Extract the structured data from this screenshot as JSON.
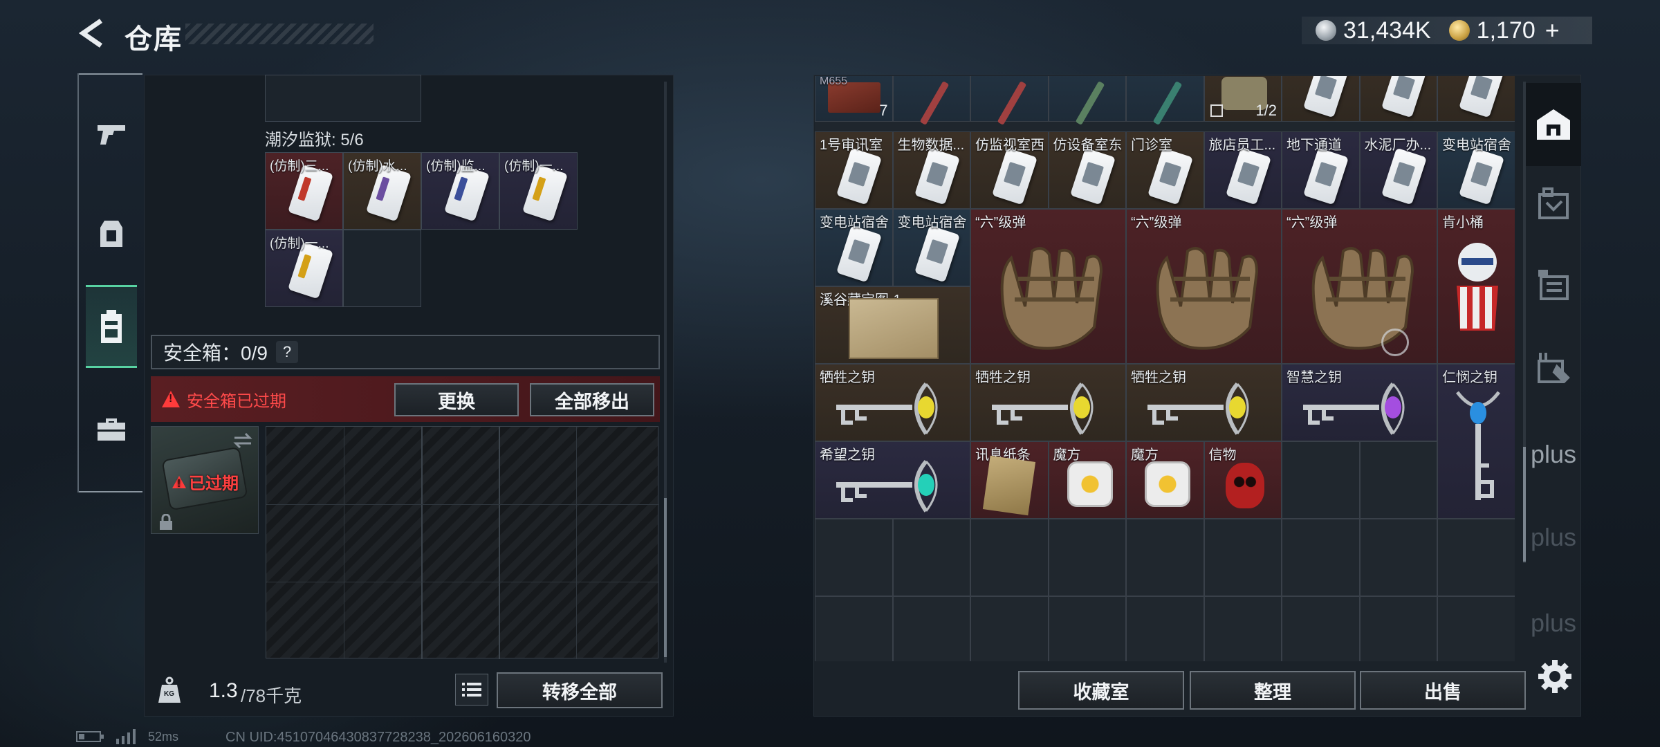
{
  "header": {
    "title": "仓库",
    "currency1": "31,434K",
    "currency2": "1,170",
    "plus": "+"
  },
  "nav": {
    "items": [
      "gun-icon",
      "armor-icon",
      "backpack-icon",
      "case-icon"
    ]
  },
  "left": {
    "tide_label": "潮汐监狱: 5/6",
    "tide_items": [
      {
        "label": "(仿制)三...",
        "color": "#c0392b",
        "bg": "bg-red"
      },
      {
        "label": "(仿制)水...",
        "color": "#6b4ea0",
        "bg": "bg-brown"
      },
      {
        "label": "(仿制)监...",
        "color": "#3b4f9a",
        "bg": "bg-purple"
      },
      {
        "label": "(仿制)一...",
        "color": "#d4a017",
        "bg": "bg-purple"
      },
      {
        "label": "(仿制)一...",
        "color": "#d4a017",
        "bg": "bg-purple"
      }
    ],
    "safe_box": "安全箱：0/9",
    "help": "?",
    "expired_warning": "安全箱已过期",
    "replace_btn": "更换",
    "move_all_out_btn": "全部移出",
    "expired_tag": "已过期",
    "weight_value": "1.3",
    "weight_max": "/78千克",
    "kg_icon_text": "KG",
    "transfer_all_btn": "转移全部"
  },
  "right": {
    "row0_count_a": "7",
    "row0_count_b": "1/2",
    "row0_label": "M655",
    "cards": [
      {
        "label": "1号审讯室",
        "bg": "bg-brown"
      },
      {
        "label": "生物数据...",
        "bg": "bg-brown"
      },
      {
        "label": "仿监视室西",
        "bg": "bg-brown"
      },
      {
        "label": "仿设备室东",
        "bg": "bg-brown"
      },
      {
        "label": "门诊室",
        "bg": "bg-brown"
      },
      {
        "label": "旅店员工...",
        "bg": "bg-purple"
      },
      {
        "label": "地下通道",
        "bg": "bg-purple"
      },
      {
        "label": "水泥厂办...",
        "bg": "bg-purple"
      },
      {
        "label": "变电站宿舍",
        "bg": "bg-blue"
      }
    ],
    "cards_row2": [
      {
        "label": "变电站宿舍",
        "bg": "bg-blue"
      },
      {
        "label": "变电站宿舍",
        "bg": "bg-blue"
      }
    ],
    "bullets": [
      "“六”级弹",
      "“六”级弹",
      "“六”级弹"
    ],
    "kfc_label": "肯小桶",
    "map_label": "溪谷藏宝图-1",
    "keys_row": [
      {
        "label": "牺牲之钥",
        "gem": "#e8d830",
        "bg": "bg-brown"
      },
      {
        "label": "牺牲之钥",
        "gem": "#e8d830",
        "bg": "bg-brown"
      },
      {
        "label": "牺牲之钥",
        "gem": "#e8d830",
        "bg": "bg-brown"
      },
      {
        "label": "智慧之钥",
        "gem": "#a44ee0",
        "bg": "bg-purple"
      }
    ],
    "renmin_label": "仁悯之钥",
    "last_row": {
      "hope": "希望之钥",
      "note": "讯息纸条",
      "cube1": "魔方",
      "cube2": "魔方",
      "token": "信物"
    },
    "buttons": {
      "collection": "收藏室",
      "sort": "整理",
      "sell": "出售"
    }
  },
  "side_icons": [
    "home-icon",
    "map-icon",
    "container-icon",
    "tools-icon",
    "plus",
    "plus",
    "plus"
  ],
  "status": {
    "latency": "52ms",
    "uid": "CN UID:451070464308377282​38_202606160320"
  }
}
